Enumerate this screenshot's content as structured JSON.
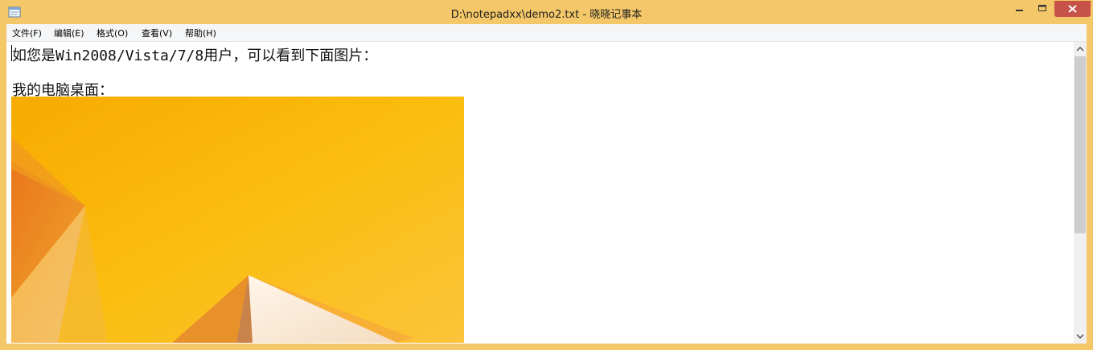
{
  "window": {
    "title": "D:\\notepadxx\\demo2.txt - 晓晓记事本"
  },
  "menu": [
    {
      "label": "文件(F)"
    },
    {
      "label": "编辑(E)"
    },
    {
      "label": "格式(O)"
    },
    {
      "label": "查看(V)"
    },
    {
      "label": "帮助(H)"
    }
  ],
  "editor": {
    "lines": [
      "如您是Win2008/Vista/7/8用户，可以看到下面图片：",
      "",
      "我的电脑桌面："
    ]
  },
  "colors": {
    "frame": "#f4c768",
    "close_button": "#c7524a",
    "image_orange": "#f9b500"
  },
  "icons": {
    "app": "notepad-icon",
    "minimize": "minimize-icon",
    "maximize": "maximize-icon",
    "close": "close-icon",
    "scroll_up": "scroll-up-arrow-icon",
    "scroll_down": "scroll-down-arrow-icon"
  }
}
